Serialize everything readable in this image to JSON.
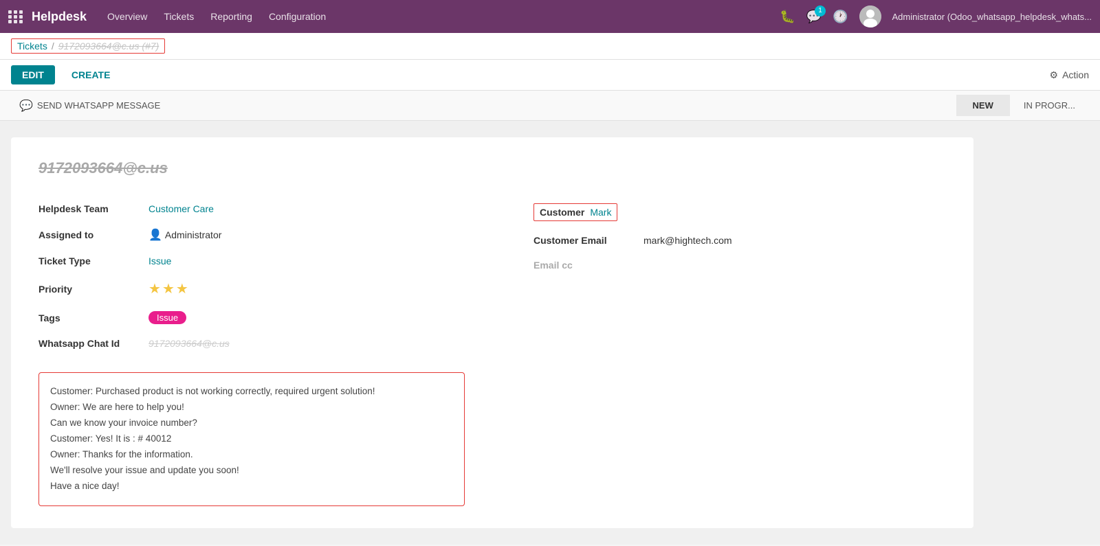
{
  "topnav": {
    "logo": "Helpdesk",
    "links": [
      "Overview",
      "Tickets",
      "Reporting",
      "Configuration"
    ],
    "notification_count": "1",
    "user": "Administrator (Odoo_whatsapp_helpdesk_whats..."
  },
  "breadcrumb": {
    "tickets_label": "Tickets",
    "separator": "/",
    "current": "9172093664@c.us (#7)"
  },
  "actions": {
    "edit_label": "EDIT",
    "create_label": "CREATE",
    "action_label": "Action"
  },
  "status_bar": {
    "whatsapp_label": "SEND WHATSAPP MESSAGE",
    "statuses": [
      "NEW",
      "IN PROGR..."
    ]
  },
  "ticket": {
    "title": "9172093664@c.us",
    "helpdesk_team_label": "Helpdesk Team",
    "helpdesk_team_value": "Customer Care",
    "assigned_label": "Assigned to",
    "assigned_value": "Administrator",
    "ticket_type_label": "Ticket Type",
    "ticket_type_value": "Issue",
    "priority_label": "Priority",
    "priority_stars": 3,
    "tags_label": "Tags",
    "tags_value": "Issue",
    "whatsapp_label": "Whatsapp Chat Id",
    "whatsapp_value": "9172093664@c.us",
    "customer_label": "Customer",
    "customer_value": "Mark",
    "customer_email_label": "Customer Email",
    "customer_email_value": "mark@hightech.com",
    "email_cc_label": "Email cc"
  },
  "chat": {
    "lines": [
      "Customer: Purchased product is not working correctly, required urgent solution!",
      "Owner: We are here to help you!",
      "Can we know your invoice number?",
      "Customer: Yes! It is : # 40012",
      "Owner: Thanks for the information.",
      "We'll resolve your issue and update you soon!",
      "Have a nice day!"
    ]
  }
}
